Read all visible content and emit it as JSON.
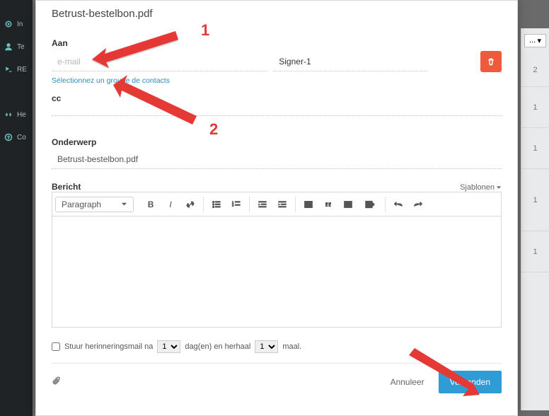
{
  "sidebar": {
    "items": [
      {
        "label": "In"
      },
      {
        "label": "Te"
      },
      {
        "label": "RE"
      },
      {
        "label": "He"
      },
      {
        "label": "Co"
      }
    ]
  },
  "modal": {
    "title": "Betrust-bestelbon.pdf",
    "to_label": "Aan",
    "email_placeholder": "e-mail",
    "role_value": "Signer-1",
    "contacts_link": "Sélectionnez un groupe de contacts",
    "cc_label": "cc",
    "subject_label": "Onderwerp",
    "subject_value": "Betrust-bestelbon.pdf",
    "message_label": "Bericht",
    "templates_label": "Sjablonen",
    "toolbar": {
      "paragraph": "Paragraph"
    },
    "reminder": {
      "prefix": "Stuur herinneringsmail na",
      "days_value": "1",
      "days_label": "dag(en) en herhaal",
      "times_value": "1",
      "times_label": "maal."
    },
    "cancel": "Annuleer",
    "send": "Verzenden"
  },
  "annotations": {
    "n1": "1",
    "n2": "2"
  },
  "rstrip": {
    "sel": "...",
    "r1": "2",
    "r2": "1",
    "r3": "1",
    "r4": "1",
    "r5": "1"
  }
}
